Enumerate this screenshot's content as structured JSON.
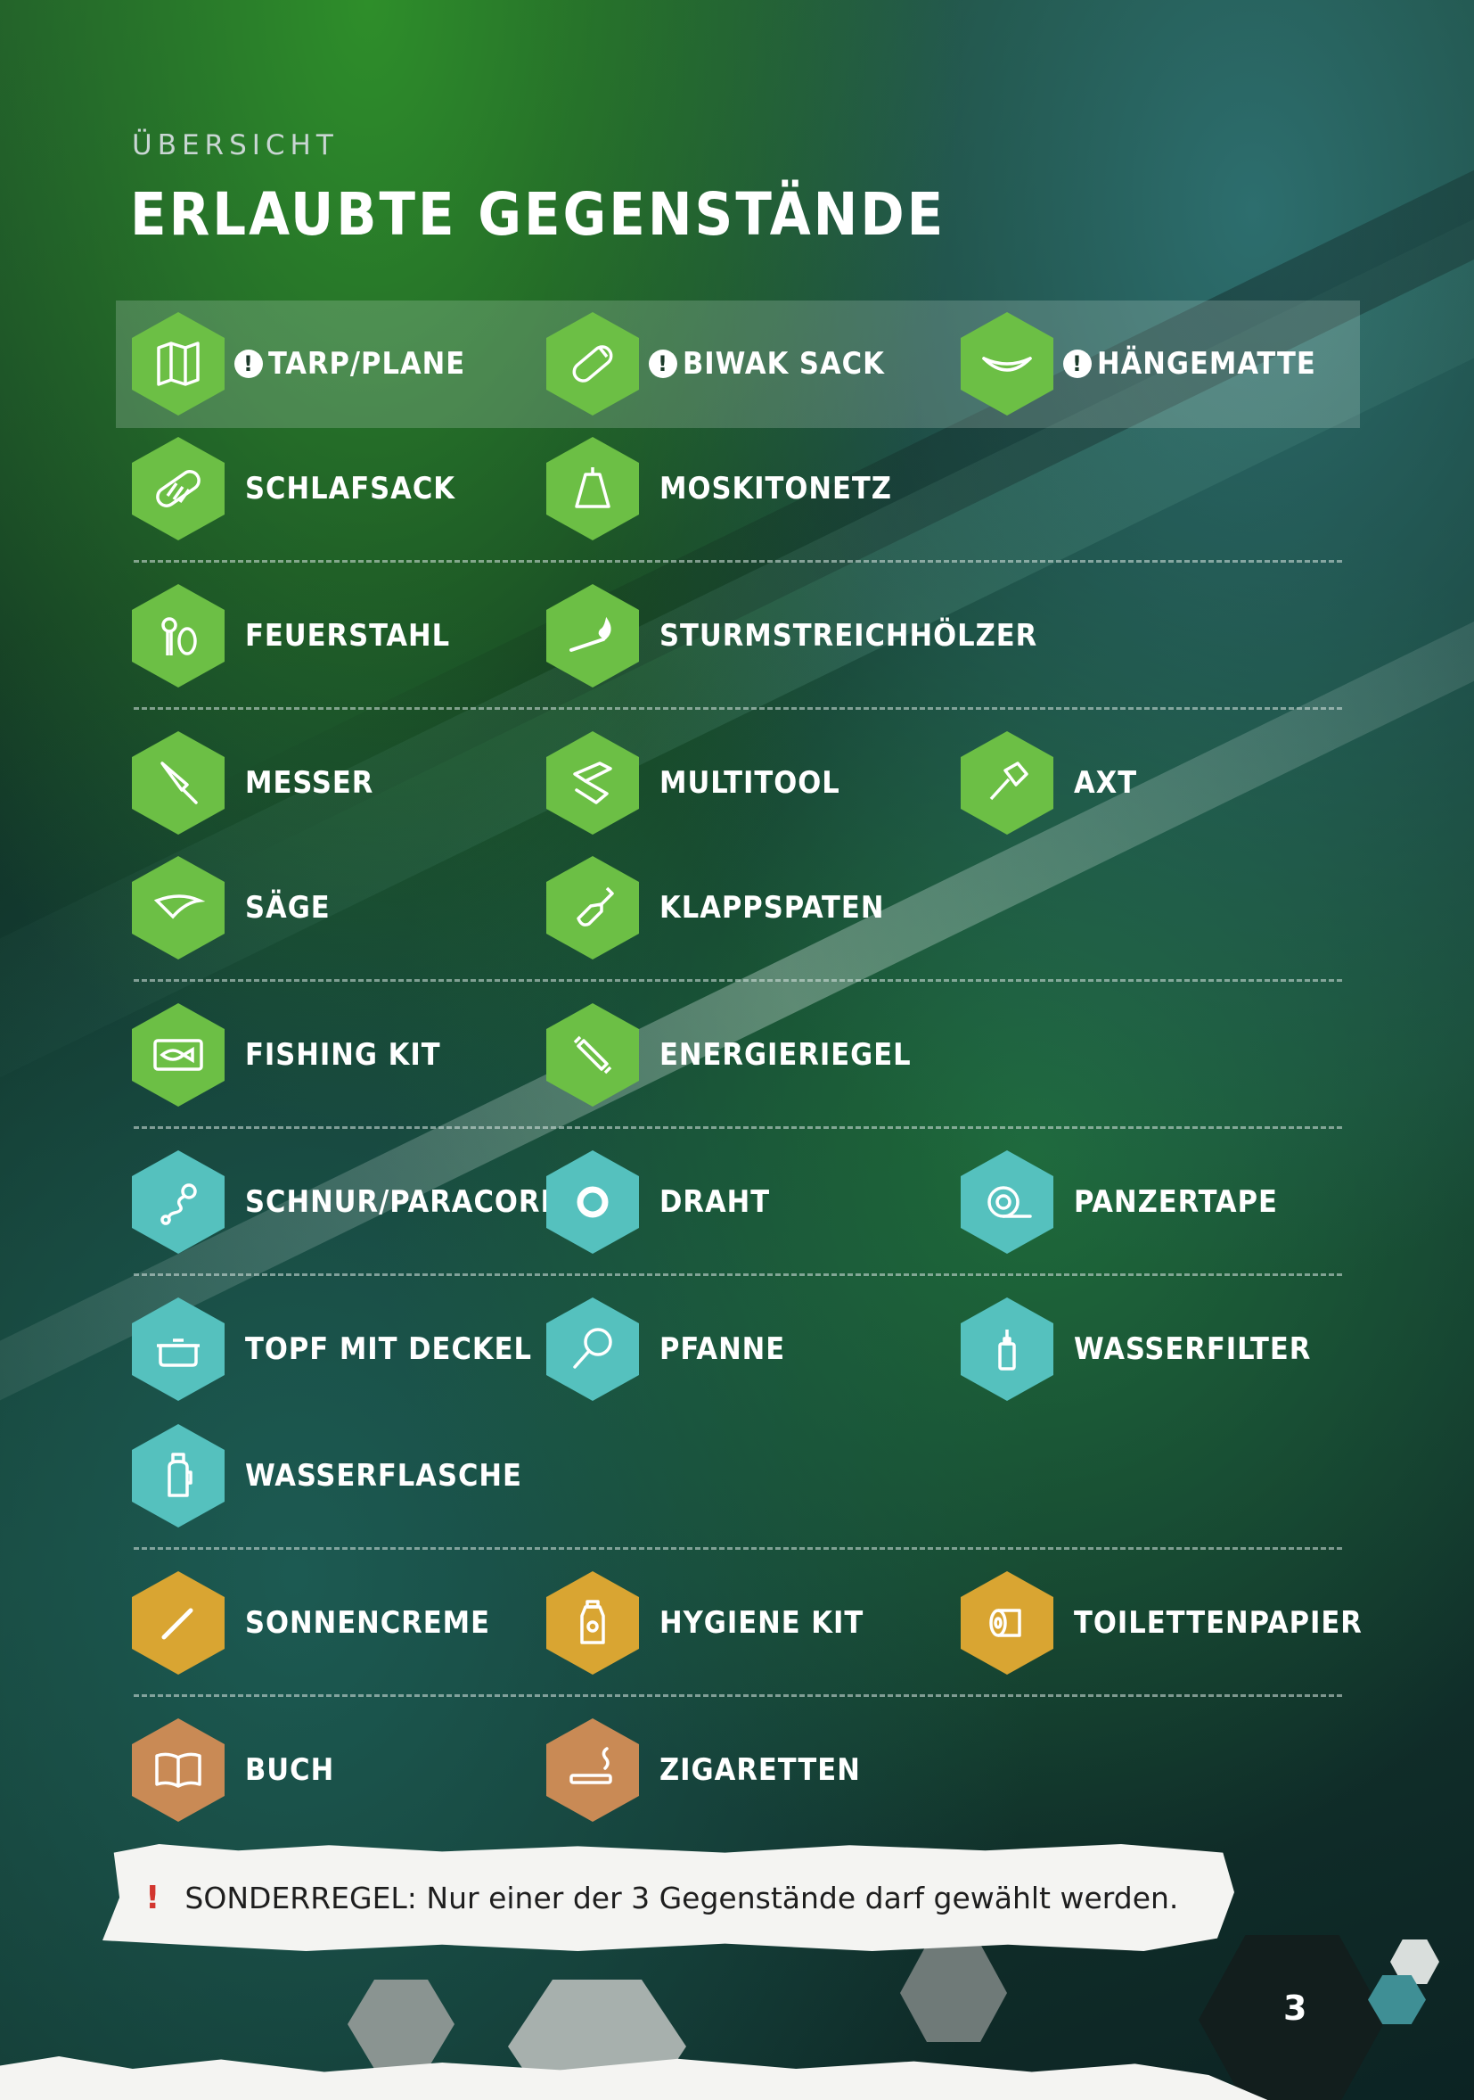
{
  "header": {
    "kicker": "ÜBERSICHT",
    "title": "ERLAUBTE GEGENSTÄNDE"
  },
  "colors": {
    "green": "#6cbf45",
    "teal": "#55c1be",
    "gold": "#d9a532",
    "tan": "#c98a55",
    "warning": "#d2362f"
  },
  "warning_marker": "!",
  "items": {
    "tarp": {
      "label": "TARP/PLANE",
      "icon": "map-icon"
    },
    "biwak": {
      "label": "BIWAK SACK",
      "icon": "bivy-bag-icon"
    },
    "haengematte": {
      "label": "HÄNGEMATTE",
      "icon": "hammock-icon"
    },
    "schlafsack": {
      "label": "SCHLAFSACK",
      "icon": "sleeping-bag-icon"
    },
    "moskitonetz": {
      "label": "MOSKITONETZ",
      "icon": "mosquito-net-icon"
    },
    "feuerstahl": {
      "label": "FEUERSTAHL",
      "icon": "fire-steel-icon"
    },
    "sturmstreichhoelzer": {
      "label": "STURMSTREICHHÖLZER",
      "icon": "storm-match-icon"
    },
    "messer": {
      "label": "MESSER",
      "icon": "knife-icon"
    },
    "multitool": {
      "label": "MULTITOOL",
      "icon": "multitool-icon"
    },
    "axt": {
      "label": "AXT",
      "icon": "axe-icon"
    },
    "saege": {
      "label": "SÄGE",
      "icon": "saw-icon"
    },
    "klappspaten": {
      "label": "KLAPPSPATEN",
      "icon": "shovel-icon"
    },
    "fishing_kit": {
      "label": "FISHING KIT",
      "icon": "fish-icon"
    },
    "energieriegel": {
      "label": "ENERGIERIEGEL",
      "icon": "energy-bar-icon"
    },
    "schnur": {
      "label": "SCHNUR/PARACORD",
      "icon": "rope-icon"
    },
    "draht": {
      "label": "DRAHT",
      "icon": "wire-ring-icon"
    },
    "panzertape": {
      "label": "PANZERTAPE",
      "icon": "tape-icon"
    },
    "topf": {
      "label": "TOPF MIT DECKEL",
      "icon": "pot-icon"
    },
    "pfanne": {
      "label": "PFANNE",
      "icon": "pan-icon"
    },
    "wasserfilter": {
      "label": "WASSERFILTER",
      "icon": "water-filter-icon"
    },
    "wasserflasche": {
      "label": "WASSERFLASCHE",
      "icon": "water-bottle-icon"
    },
    "sonnencreme": {
      "label": "SONNENCREME",
      "icon": "sunscreen-icon"
    },
    "hygiene_kit": {
      "label": "HYGIENE KIT",
      "icon": "hygiene-bottle-icon"
    },
    "toilettenpapier": {
      "label": "TOILETTENPAPIER",
      "icon": "toilet-paper-icon"
    },
    "buch": {
      "label": "BUCH",
      "icon": "book-icon"
    },
    "zigaretten": {
      "label": "ZIGARETTEN",
      "icon": "cigarette-icon"
    }
  },
  "note": {
    "marker": "!",
    "text": "SONDERREGEL: Nur einer der 3 Gegenstände darf gewählt werden."
  },
  "page_number": "3"
}
